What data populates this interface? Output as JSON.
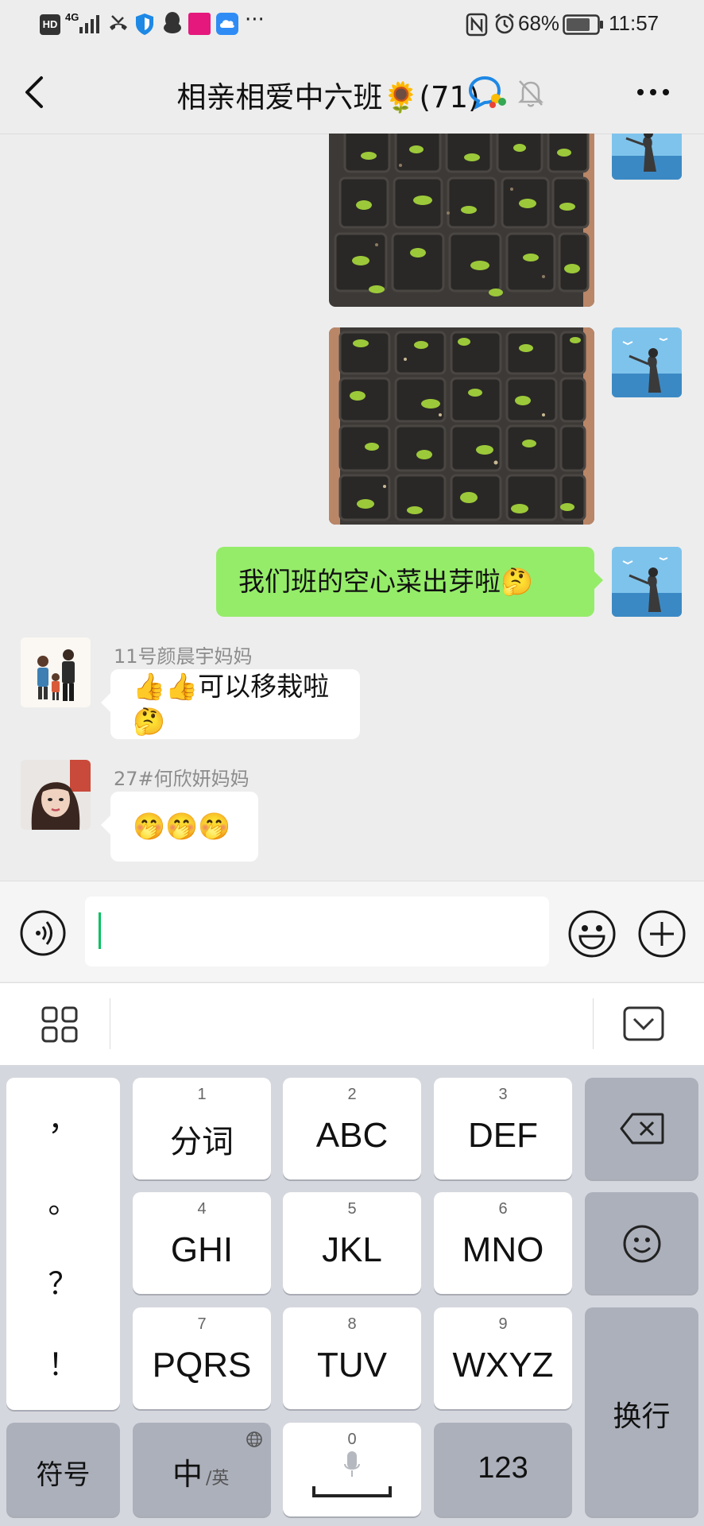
{
  "status_bar": {
    "hd": "HD",
    "network": "4G",
    "battery": "68%",
    "time": "11:57",
    "more": "···"
  },
  "header": {
    "title": "相亲相爱中六班🌻(71)"
  },
  "messages": [
    {
      "type": "image",
      "from": "me"
    },
    {
      "type": "image",
      "from": "me"
    },
    {
      "type": "text",
      "from": "me",
      "text": "我们班的空心菜出芽啦🤔"
    },
    {
      "type": "text",
      "from": "other",
      "sender": "11号颜晨宇妈妈",
      "text": "👍👍可以移栽啦🤔"
    },
    {
      "type": "text",
      "from": "other",
      "sender": "27#何欣妍妈妈",
      "text": "🤭🤭🤭"
    }
  ],
  "keyboard": {
    "punctuation": [
      "，",
      "。",
      "？",
      "！"
    ],
    "rows": [
      [
        {
          "num": "1",
          "label": "分词"
        },
        {
          "num": "2",
          "label": "ABC"
        },
        {
          "num": "3",
          "label": "DEF"
        }
      ],
      [
        {
          "num": "4",
          "label": "GHI"
        },
        {
          "num": "5",
          "label": "JKL"
        },
        {
          "num": "6",
          "label": "MNO"
        }
      ],
      [
        {
          "num": "7",
          "label": "PQRS"
        },
        {
          "num": "8",
          "label": "TUV"
        },
        {
          "num": "9",
          "label": "WXYZ"
        }
      ]
    ],
    "symbols_label": "符号",
    "lang_main": "中",
    "lang_alt": "/英",
    "space_num": "0",
    "num_label": "123",
    "enter_label": "换行"
  },
  "colors": {
    "my_bubble": "#95ec69",
    "other_bubble": "#ffffff",
    "caret": "#07c160"
  }
}
